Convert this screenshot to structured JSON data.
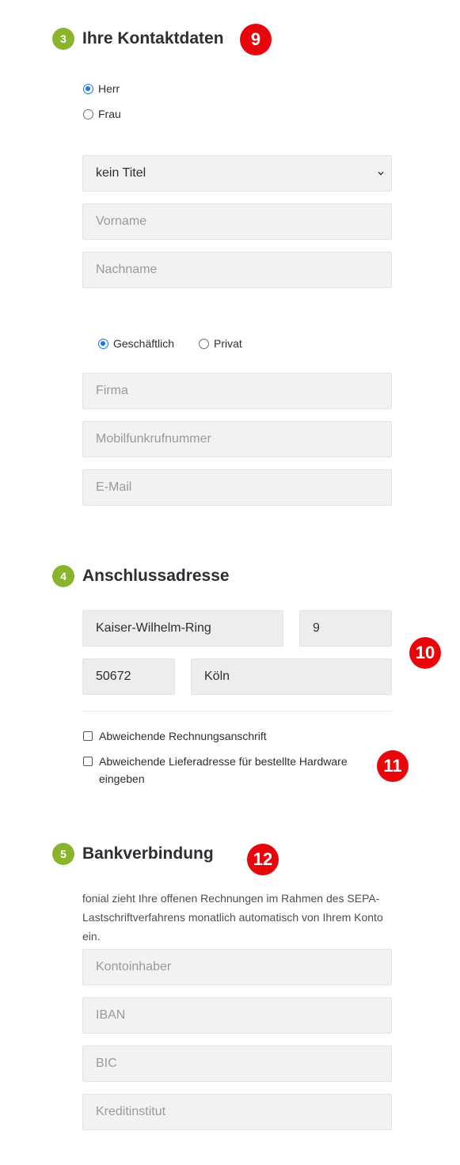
{
  "contact": {
    "step": "3",
    "title": "Ihre Kontaktdaten",
    "annotation": "9",
    "salutation": [
      {
        "label": "Herr",
        "checked": true
      },
      {
        "label": "Frau",
        "checked": false
      }
    ],
    "title_select": {
      "value": "kein Titel"
    },
    "firstname_placeholder": "Vorname",
    "lastname_placeholder": "Nachname",
    "customer_type": [
      {
        "label": "Geschäftlich",
        "checked": true
      },
      {
        "label": "Privat",
        "checked": false
      }
    ],
    "company_placeholder": "Firma",
    "mobile_placeholder": "Mobilfunkrufnummer",
    "email_placeholder": "E-Mail"
  },
  "address": {
    "step": "4",
    "title": "Anschlussadresse",
    "annotation": "10",
    "street": "Kaiser-Wilhelm-Ring",
    "house_number": "9",
    "zip": "50672",
    "city": "Köln",
    "billing_checkbox_label": "Abweichende Rechnungsanschrift",
    "delivery_checkbox_label": "Abweichende Lieferadresse für bestellte Hardware eingeben",
    "checkbox_annotation": "11"
  },
  "bank": {
    "step": "5",
    "title": "Bankverbindung",
    "annotation": "12",
    "description": "fonial zieht Ihre offenen Rechnungen im Rahmen des SEPA-Lastschriftverfahrens monatlich automatisch von Ihrem Konto ein.",
    "account_holder_placeholder": "Kontoinhaber",
    "iban_placeholder": "IBAN",
    "bic_placeholder": "BIC",
    "bank_name_placeholder": "Kreditinstitut"
  },
  "colors": {
    "step_badge": "#8ab42b",
    "annotation": "#e8060b",
    "radio_checked": "#1a73e8",
    "field_background": "#f2f2f2"
  }
}
